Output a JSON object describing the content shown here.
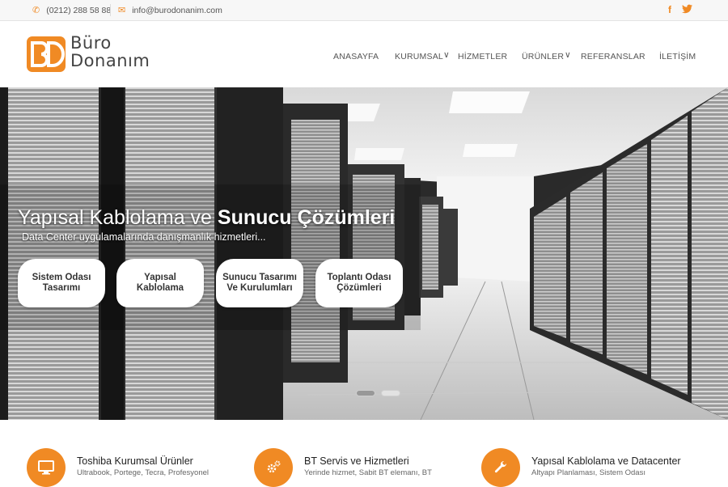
{
  "topbar": {
    "phone": "(0212) 288 58 88",
    "email": "info@burodonanim.com",
    "social": [
      "facebook",
      "twitter"
    ],
    "icons": {
      "phone": "phone-icon",
      "email": "envelope-icon"
    }
  },
  "brand": {
    "line1": "Büro",
    "line2": "Donanım",
    "mark": "BD",
    "color": "#f08a24"
  },
  "nav": [
    {
      "label": "ANASAYFA",
      "has_submenu": false
    },
    {
      "label": "KURUMSAL",
      "has_submenu": true
    },
    {
      "label": "HİZMETLER",
      "has_submenu": false
    },
    {
      "label": "ÜRÜNLER",
      "has_submenu": true
    },
    {
      "label": "REFERANSLAR",
      "has_submenu": false
    },
    {
      "label": "İLETİŞİM",
      "has_submenu": false
    }
  ],
  "hero": {
    "headline_light": "Yapısal Kablolama ve ",
    "headline_bold": "Sunucu Çözümleri",
    "subtitle": "Data Center uygulamalarında danışmanlık hizmetleri...",
    "services": [
      {
        "label": "Sistem Odası Tasarımı"
      },
      {
        "label": "Yapısal Kablolama"
      },
      {
        "label": "Sunucu Tasarımı Ve Kurulumları"
      },
      {
        "label": "Toplantı Odası Çözümleri"
      }
    ],
    "slides": {
      "count": 2,
      "active": 2
    }
  },
  "features": [
    {
      "title": "Toshiba Kurumsal Ürünler",
      "desc": "Ultrabook, Portege, Tecra, Profesyonel",
      "icon": "monitor-icon"
    },
    {
      "title": "BT Servis ve Hizmetleri",
      "desc": "Yerinde hizmet, Sabit BT elemanı, BT",
      "icon": "gears-icon"
    },
    {
      "title": "Yapısal Kablolama ve Datacenter",
      "desc": "Altyapı Planlaması, Sistem Odası",
      "icon": "wrench-icon"
    }
  ]
}
